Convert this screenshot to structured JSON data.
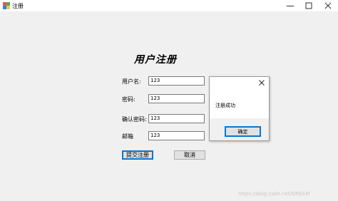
{
  "window": {
    "title": "注册",
    "icons": {
      "app": "app-icon",
      "minimize": "minimize-icon",
      "maximize": "maximize-icon",
      "close": "close-icon"
    }
  },
  "form": {
    "heading": "用户注册",
    "fields": [
      {
        "label": "用户名:",
        "value": "123"
      },
      {
        "label": "密码:",
        "value": "123"
      },
      {
        "label": "确认密码:",
        "value": "123"
      },
      {
        "label": "邮箱",
        "value": "123"
      }
    ],
    "submit_label": "提交注册",
    "cancel_label": "取消"
  },
  "dialog": {
    "message": "注册成功",
    "ok_label": "确定",
    "close_icon": "close-icon"
  },
  "watermark": "https://blog.csdn.net/DREAM"
}
